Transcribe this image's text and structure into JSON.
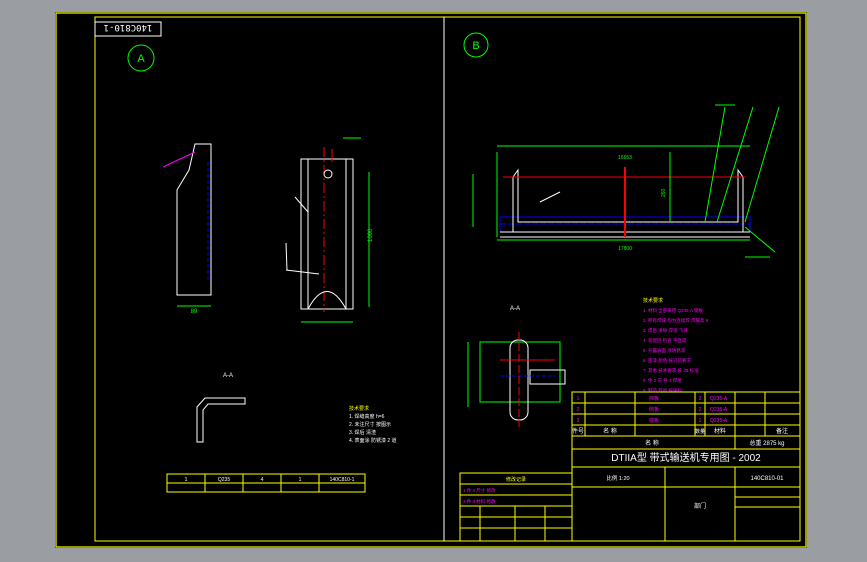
{
  "colors": {
    "frame": "#ffff00",
    "part": "#ffffff",
    "center": "#ff0000",
    "dimension": "#00ff00",
    "hidden": "#0000ff",
    "annotation": "#ff00ff",
    "paper": "#000000",
    "window": "#9a9da2"
  },
  "sheet": {
    "drawing_number_stamp": "140C810-1",
    "view_a_label": "A",
    "view_b_label": "B"
  },
  "view_a": {
    "dim_overall_width": "89",
    "dim_overall_height": "1000",
    "detail_label": "A-A"
  },
  "view_b": {
    "dim_inner_length": "16653",
    "dim_overall_length": "17800",
    "dim_height": "260",
    "detail_label": "A-A"
  },
  "title_block": {
    "drawing_title": "DTIIA型 带式输送机专用图 - 2002",
    "drawing_code": "140C810-01",
    "scale_label": "比例 1:20",
    "total_weight": "总重 2875 kg",
    "header_row": [
      "件号",
      "名 称",
      "数量",
      "材料",
      "备注"
    ],
    "org_name": "部门"
  },
  "parts_table_b": {
    "rows": [
      [
        "1",
        "挡板",
        "2",
        "Q235-A"
      ],
      [
        "2",
        "侧板",
        "2",
        "Q235-A"
      ],
      [
        "3",
        "底板",
        "1",
        "Q235-A"
      ]
    ]
  },
  "parts_table_a": {
    "row": [
      "1",
      "Q235",
      "4",
      "1",
      "140C810-1"
    ]
  },
  "notes_a": {
    "heading": "技术要求",
    "lines": [
      "1. 焊缝高度 h=6",
      "2. 未注尺寸 按图示",
      "3. 焊后 清渣",
      "4. 表面涂 防锈漆 2 道"
    ]
  },
  "notes_b": {
    "heading": "技术要求",
    "lines": [
      "1. 材料 全部采用 Q235-A 钢板",
      "2. 所有焊缝 均为连续焊 焊脚高 6",
      "3. 焊后 清除 焊渣 飞溅",
      "4. 装配后 检查 平直度",
      "5. 外露表面 涂防锈漆",
      "6. 面漆 颜色 按订货要求",
      "7. 其余 技术要求 按 JB 标准",
      "8. 件 2 与 件 3 焊接",
      "9. 制造 检验 按国标"
    ]
  },
  "revision_block": {
    "heading": "修改记录",
    "lines": [
      "1 件 2 尺寸 修改",
      "2 件 3 材料 修改"
    ]
  }
}
